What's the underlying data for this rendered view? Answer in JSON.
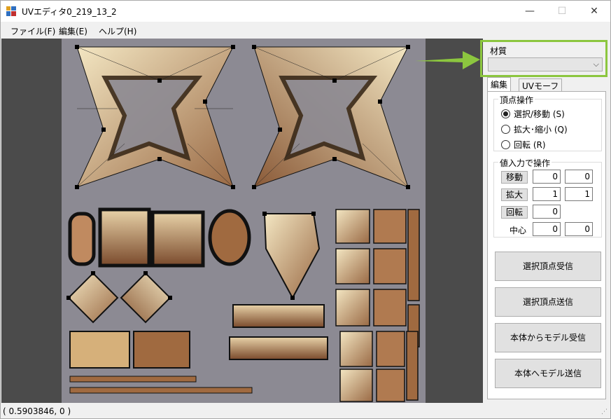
{
  "window": {
    "title": "UVエディタ0_219_13_2",
    "minimize": "—",
    "maximize": "☐",
    "close": "✕"
  },
  "menu": [
    {
      "label": "ファイル(F)"
    },
    {
      "label": "編集(E)"
    },
    {
      "label": "ヘルプ(H)"
    }
  ],
  "panel": {
    "material_label": "材質",
    "material_value": "",
    "tabs": [
      "編集",
      "UVモーフ"
    ],
    "vertex_group": {
      "title": "頂点操作",
      "options": [
        "選択/移動 (S)",
        "拡大･縮小 (Q)",
        "回転 (R)"
      ],
      "selected": 0
    },
    "value_group": {
      "title": "値入力で操作",
      "move_label": "移動",
      "move_x": "0",
      "move_y": "0",
      "scale_label": "拡大",
      "scale_x": "1",
      "scale_y": "1",
      "rotate_label": "回転",
      "rotate_value": "0",
      "center_label": "中心",
      "center_x": "0",
      "center_y": "0"
    },
    "buttons": {
      "receive_selected": "選択頂点受信",
      "send_selected": "選択頂点送信",
      "receive_model": "本体からモデル受信",
      "send_model": "本体へモデル送信"
    }
  },
  "status": {
    "coords": "( 0.5903846, 0 )"
  },
  "colors": {
    "accent": "#8cc63f",
    "canvas_bg": "#4b4b4b",
    "uv_bg": "#8c8a93"
  }
}
